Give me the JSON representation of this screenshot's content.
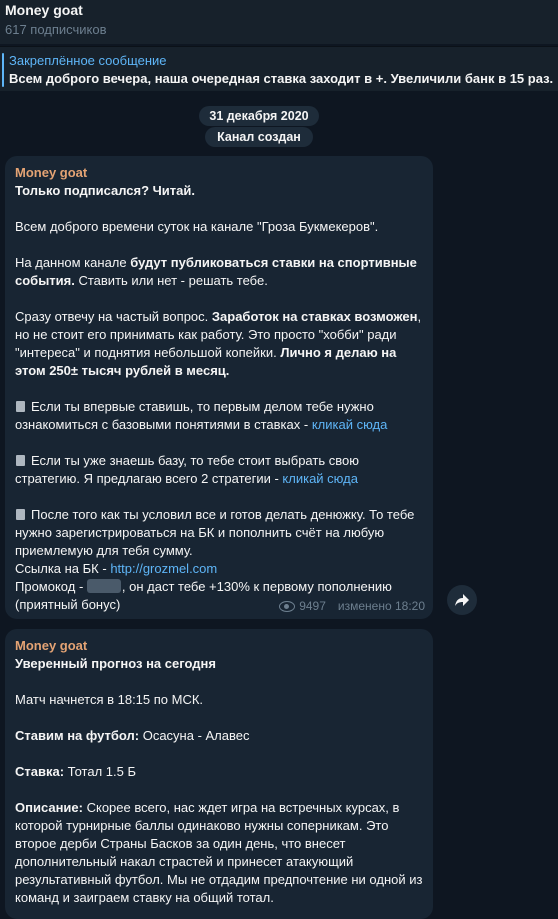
{
  "header": {
    "title": "Money goat",
    "subscribers": "617 подписчиков"
  },
  "pinned": {
    "title": "Закреплённое сообщение",
    "text": "Всем доброго вечера, наша очередная ставка заходит в +. Увеличили банк в 15 раз."
  },
  "service": {
    "date": "31 декабря 2020",
    "created": "Канал создан"
  },
  "post1": {
    "author": "Money goat",
    "title": "Только подписался? Читай.",
    "p1": "Всем доброго времени суток на канале \"Гроза Букмекеров\".",
    "p2_a": "На данном канале ",
    "p2_b": "будут публиковаться ставки на спортивные события.",
    "p2_c": " Ставить или нет - решать тебе.",
    "p3_a": "Сразу отвечу на частый вопрос. ",
    "p3_b": "Заработок на ставках возможен",
    "p3_c": ", но не стоит его принимать как работу. Это просто \"хобби\" ради \"интереса\" и поднятия небольшой копейки. ",
    "p3_d": "Лично я делаю на этом 250± тысяч рублей в месяц.",
    "p4": "Если ты впервые ставишь, то первым делом тебе нужно ознакомиться с базовыми понятиями в ставках - ",
    "p4_link": "кликай сюда",
    "p5": "Если ты уже знаешь базу, то тебе стоит выбрать свою стратегию. Я предлагаю всего 2 стратегии - ",
    "p5_link": "кликай сюда",
    "p6": "После того как ты условил все и готов делать денюжку. То тебе нужно зарегистрироваться на БК и пополнить счёт на любую приемлемую для тебя сумму.",
    "p7": "Ссылка на БК - ",
    "p7_link": "http://grozmel.com",
    "p8_a": "Промокод - ",
    "p8_b": ", он даст тебе +130% к первому пополнению (приятный бонус)",
    "views": "9497",
    "edited": "изменено 18:20"
  },
  "post2": {
    "author": "Money goat",
    "title": "Уверенный прогноз на сегодня",
    "p1": "Матч начнется в 18:15 по МСК.",
    "p2_label": "Ставим на футбол:",
    "p2_value": " Осасуна - Алавес",
    "p3_label": "Ставка:",
    "p3_value": " Тотал 1.5 Б",
    "p4_label": "Описание:",
    "p4_value": " Скорее всего, нас ждет игра на встречных курсах, в которой турнирные баллы одинаково нужны соперникам. Это второе дерби Страны Басков за один день, что внесет дополнительный накал страстей и принесет атакующий результативный футбол. Мы не отдадим предпочтение ни одной из команд и заиграем ставку на общий тотал."
  },
  "colors": {
    "bg": "#0e1621",
    "bubble": "#182533",
    "accent": "#5eb5f7",
    "author": "#e4a374"
  }
}
